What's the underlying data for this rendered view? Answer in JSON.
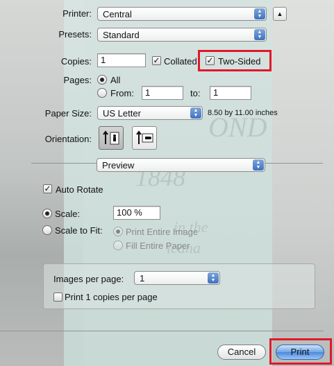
{
  "printer": {
    "label": "Printer:",
    "value": "Central"
  },
  "presets": {
    "label": "Presets:",
    "value": "Standard"
  },
  "copies": {
    "label": "Copies:",
    "value": "1",
    "collated_label": "Collated",
    "collated_checked": true,
    "two_sided_label": "Two-Sided",
    "two_sided_checked": true
  },
  "pages": {
    "label": "Pages:",
    "all_label": "All",
    "from_label": "From:",
    "from_value": "1",
    "to_label": "to:",
    "to_value": "1"
  },
  "paper_size": {
    "label": "Paper Size:",
    "value": "US Letter",
    "dimensions": "8.50 by 11.00 inches"
  },
  "orientation": {
    "label": "Orientation:"
  },
  "section": {
    "value": "Preview"
  },
  "preview": {
    "auto_rotate_label": "Auto Rotate",
    "scale_label": "Scale:",
    "scale_value": "100 %",
    "scale_to_fit_label": "Scale to Fit:",
    "print_entire_image_label": "Print Entire Image",
    "fill_entire_paper_label": "Fill Entire Paper",
    "images_per_page_label": "Images per page:",
    "images_per_page_value": "1",
    "print_copies_label": "Print 1 copies per page"
  },
  "buttons": {
    "cancel": "Cancel",
    "print": "Print"
  },
  "colors": {
    "highlight": "#e0182a",
    "accent": "#3c72c1"
  }
}
